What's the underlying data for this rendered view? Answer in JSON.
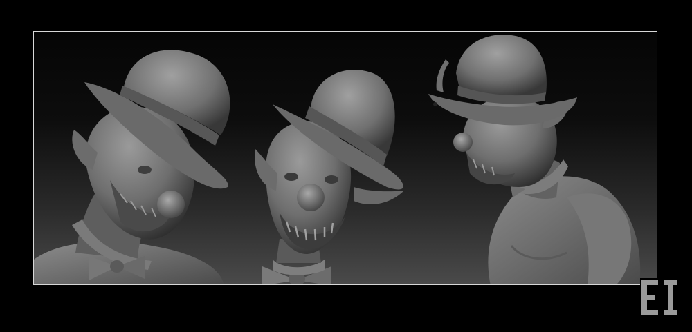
{
  "scene": {
    "subject": "clown-sculpt-turnaround",
    "views": [
      {
        "id": "three-quarter-left"
      },
      {
        "id": "front"
      },
      {
        "id": "side-right"
      }
    ]
  },
  "colors": {
    "background": "#000000",
    "frame_border": "#d8d8d8",
    "gradient_top": "#050505",
    "gradient_bottom": "#4a4a4a",
    "clay_light": "#8a8a8a",
    "clay_mid": "#6a6a6a",
    "clay_dark": "#3c3c3c",
    "logo": "#9a9a9a"
  },
  "logo": {
    "icon": "studio-logo-icon",
    "text": "EI"
  }
}
